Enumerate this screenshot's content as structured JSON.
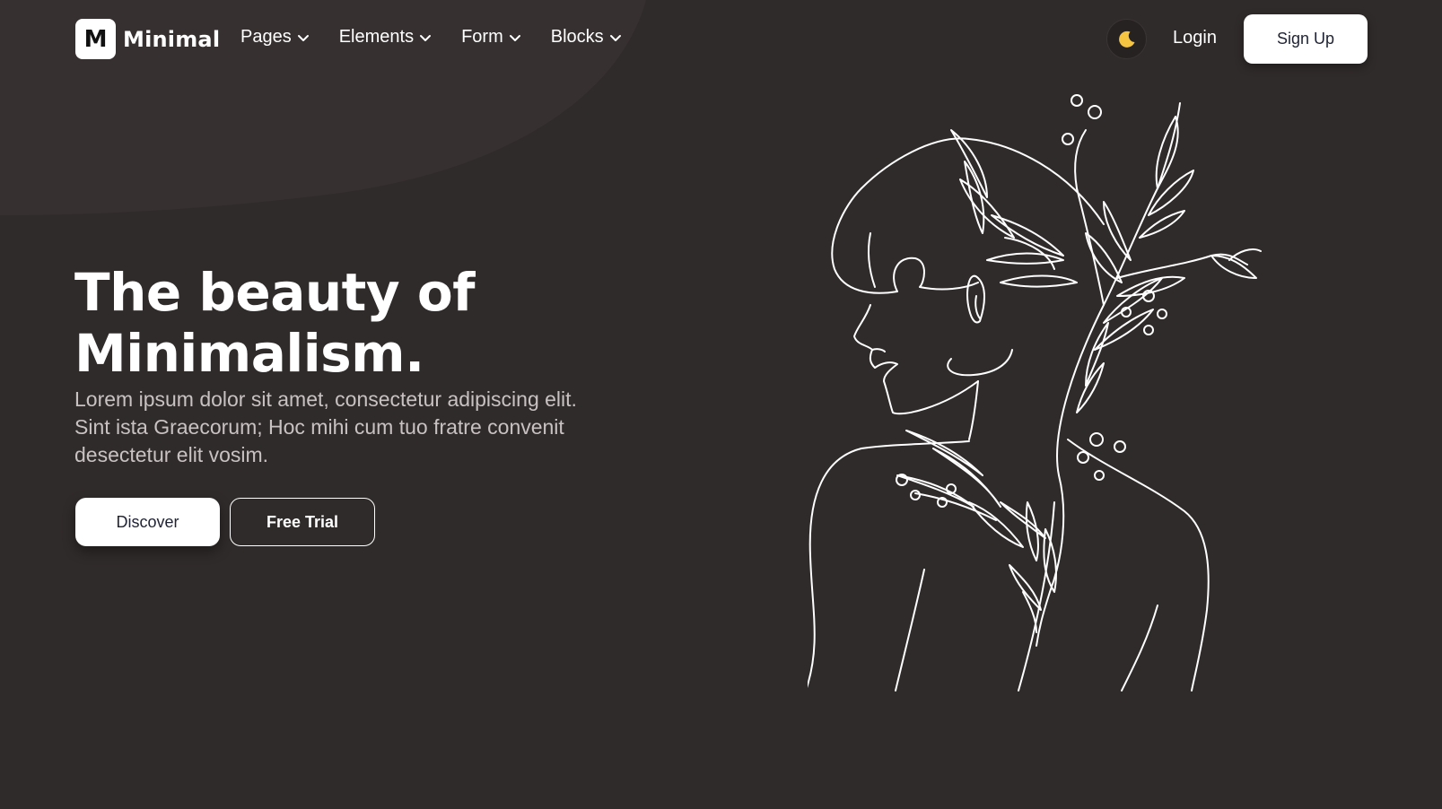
{
  "brand": {
    "logo_letter": "M",
    "name": "Minimal"
  },
  "nav": {
    "items": [
      {
        "label": "Pages"
      },
      {
        "label": "Elements"
      },
      {
        "label": "Form"
      },
      {
        "label": "Blocks"
      }
    ],
    "login_label": "Login",
    "signup_label": "Sign Up",
    "theme_icon": "moon-icon"
  },
  "hero": {
    "title_line1": "The beauty of",
    "title_line2": "Minimalism.",
    "text": "Lorem ipsum dolor sit amet, consectetur adipiscing elit. Sint ista Graecorum; Hoc mihi cum tuo fratre convenit desectetur elit vosim.",
    "primary_button": "Discover",
    "secondary_button": "Free Trial",
    "illustration": "line-art-woman-with-plants"
  },
  "colors": {
    "background": "#302b2b",
    "accent": "#f5c542",
    "button_text": "#1e2233"
  }
}
